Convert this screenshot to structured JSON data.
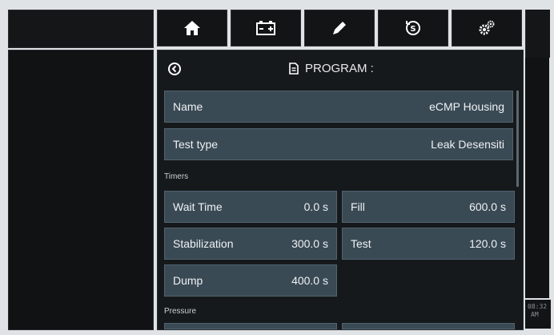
{
  "toolbar": {
    "items": [
      {
        "icon": "home-icon"
      },
      {
        "icon": "battery-icon"
      },
      {
        "icon": "pencil-icon"
      },
      {
        "icon": "currency-icon"
      },
      {
        "icon": "gears-icon"
      }
    ]
  },
  "header": {
    "title": "PROGRAM :",
    "back_icon": "back-icon",
    "doc_icon": "document-icon"
  },
  "program": {
    "name_label": "Name",
    "name_value": "eCMP Housing",
    "test_type_label": "Test type",
    "test_type_value": "Leak Desensiti"
  },
  "timers": {
    "section_label": "Timers",
    "wait_time_label": "Wait Time",
    "wait_time_value": "0.0 s",
    "fill_label": "Fill",
    "fill_value": "600.0 s",
    "stabilization_label": "Stabilization",
    "stabilization_value": "300.0 s",
    "test_label": "Test",
    "test_value": "120.0 s",
    "dump_label": "Dump",
    "dump_value": "400.0 s"
  },
  "pressure": {
    "section_label": "Pressure"
  },
  "clock": {
    "time": "08:32",
    "ampm": "AM"
  },
  "colors": {
    "panel_dark": "#16191b",
    "row_fill": "#3a4a55",
    "row_border": "#51636f",
    "text": "#eef1f3"
  }
}
